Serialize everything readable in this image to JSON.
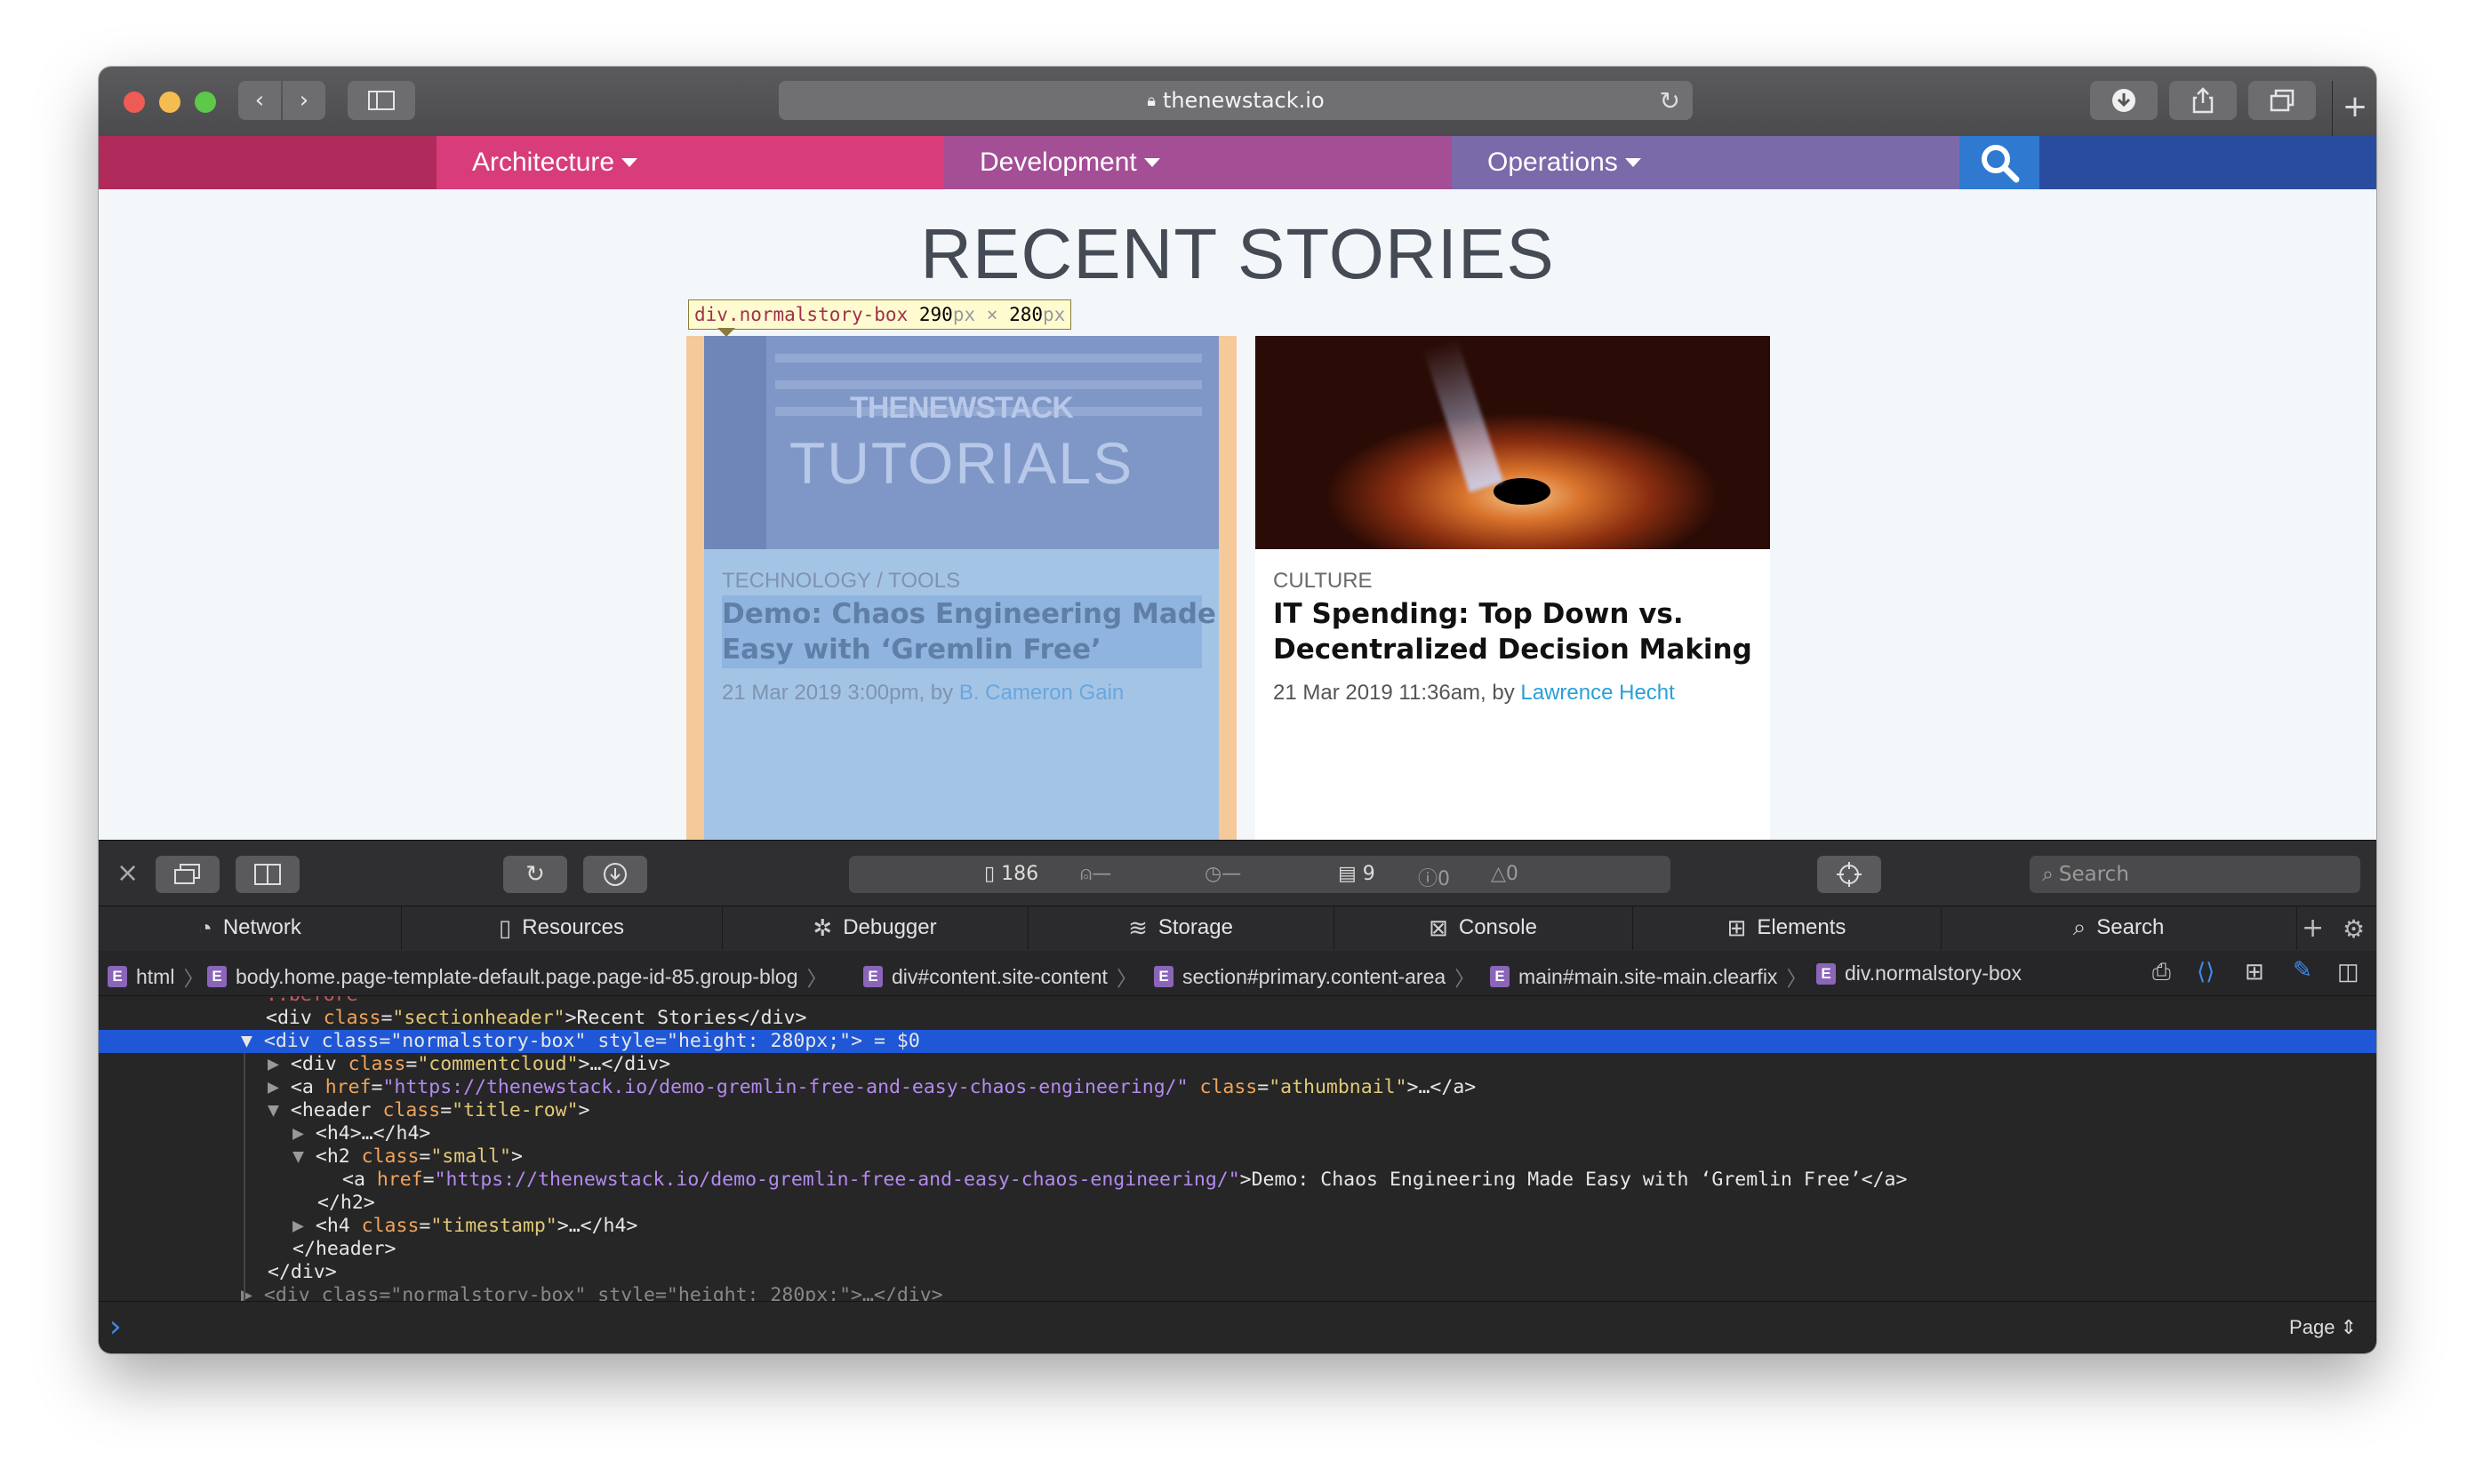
{
  "browser": {
    "url": "thenewstack.io",
    "colors": {
      "close": "#ee5c55",
      "minimize": "#f5bd4f",
      "zoom": "#5dc84a"
    }
  },
  "site_nav": {
    "items": [
      {
        "label": "Architecture",
        "color": "#d83c7a"
      },
      {
        "label": "Development",
        "color": "#a44e96"
      },
      {
        "label": "Operations",
        "color": "#7a6aa9"
      }
    ]
  },
  "section_title": "RECENT STORIES",
  "inspector_tooltip": {
    "selector": "div.normalstory-box",
    "width": "290",
    "height": "280",
    "unit": "px",
    "times": "×"
  },
  "stories": [
    {
      "category": "TECHNOLOGY / TOOLS",
      "title_line1": "Demo: Chaos Engineering Made",
      "title_line2": "Easy with ‘Gremlin Free’",
      "meta": "21 Mar 2019 3:00pm, by ",
      "author": "B. Cameron Gain",
      "thumb_text_top": "THENEWSTACK",
      "thumb_text_bottom": "TUTORIALS"
    },
    {
      "category": "CULTURE",
      "title_line1": "IT Spending: Top Down vs.",
      "title_line2": "Decentralized Decision Making",
      "meta": "21 Mar 2019 11:36am, by ",
      "author": "Lawrence Hecht"
    }
  ],
  "devtools": {
    "status": {
      "resources": "186",
      "dash1": "—",
      "dash2": "—",
      "logs": "9",
      "errors": "0",
      "warnings": "0"
    },
    "search_placeholder": "Search",
    "tabs": [
      {
        "label": "Network",
        "icon": "network-icon"
      },
      {
        "label": "Resources",
        "icon": "resources-icon"
      },
      {
        "label": "Debugger",
        "icon": "debugger-icon"
      },
      {
        "label": "Storage",
        "icon": "storage-icon"
      },
      {
        "label": "Console",
        "icon": "console-icon"
      },
      {
        "label": "Elements",
        "icon": "elements-icon"
      },
      {
        "label": "Search",
        "icon": "search-icon"
      }
    ],
    "breadcrumbs": [
      "html",
      "body.home.page-template-default.page.page-id-85.group-blog",
      "div#content.site-content",
      "section#primary.content-area",
      "main#main.site-main.clearfix",
      "div.normalstory-box"
    ],
    "badge_letter": "E",
    "dom": {
      "before": "::before",
      "l1": {
        "open": "<div ",
        "attr": "class",
        "val": "\"sectionheader\"",
        "text": ">Recent Stories</div>"
      },
      "l2": {
        "open": "<div ",
        "attr1": "class",
        "val1": "\"normalstory-box\"",
        "attr2": "style",
        "val2": "\"height: 280px;\"",
        "tail": "> = $0"
      },
      "l3": {
        "open": "<div ",
        "attr": "class",
        "val": "\"commentcloud\"",
        "tail": ">…</div>"
      },
      "l4": {
        "open": "<a ",
        "attr1": "href",
        "val1": "\"https://thenewstack.io/demo-gremlin-free-and-easy-chaos-engineering/\"",
        "attr2": "class",
        "val2": "\"athumbnail\"",
        "tail": ">…</a>"
      },
      "l5": {
        "open": "<header ",
        "attr": "class",
        "val": "\"title-row\"",
        "tail": ">"
      },
      "l6": "<h4>…</h4>",
      "l7": {
        "open": "<h2 ",
        "attr": "class",
        "val": "\"small\"",
        "tail": ">"
      },
      "l8": {
        "open": "<a ",
        "attr": "href",
        "val": "\"https://thenewstack.io/demo-gremlin-free-and-easy-chaos-engineering/\"",
        "tail": ">Demo: Chaos Engineering Made Easy with ‘Gremlin Free’</a>"
      },
      "l9": "</h2>",
      "l10": {
        "open": "<h4 ",
        "attr": "class",
        "val": "\"timestamp\"",
        "tail": ">…</h4>"
      },
      "l11": "</header>",
      "l12": "</div>",
      "l13": "<div class=\"normalstory-box\" style=\"height: 280px;\">…</div>"
    },
    "console_prompt": "›",
    "context_label": "Page"
  }
}
